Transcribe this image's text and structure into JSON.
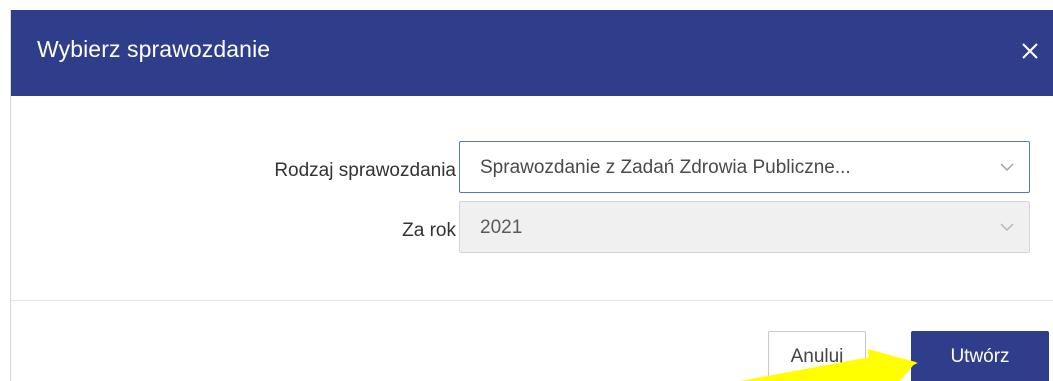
{
  "dialog": {
    "title": "Wybierz sprawozdanie",
    "close_icon": "close-icon"
  },
  "form": {
    "report_type": {
      "label": "Rodzaj sprawozdania",
      "value": "Sprawozdanie z Zadań Zdrowia Publiczne..."
    },
    "year": {
      "label": "Za rok",
      "value": "2021"
    }
  },
  "footer": {
    "cancel_label": "Anuluj",
    "create_label": "Utwórz"
  },
  "colors": {
    "header_bg": "#2f3e8a",
    "primary_button": "#2f3e8a",
    "annotation_arrow": "#ffff00"
  }
}
